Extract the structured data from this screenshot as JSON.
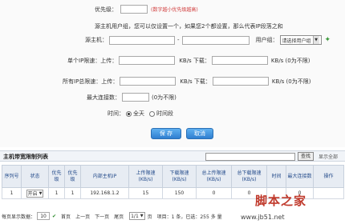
{
  "form": {
    "priority_label": "优先级：",
    "priority_hint": "(数字越小优先级越高)",
    "note_text": "源主机用户组，您可以仅设置一个，如果您2个都设置，那么代表IP段落之和",
    "source_host_label": "源主机：",
    "range_sep": "-",
    "user_group_label": "用户组：",
    "user_group_select": "请选择用户组",
    "single_ip_label": "单个IP限速：上传：",
    "all_ip_label": "所有IP总限速：上传：",
    "download_label": "KB/s  下载：",
    "kbs_no_limit": "KB/s (0为不限)",
    "max_conn_label": "最大连接数：",
    "max_conn_hint": "(0为不限)",
    "time_label": "时间：",
    "time_all": "全天",
    "time_period": "时间段",
    "save_button": "保 存",
    "cancel_button": "取消"
  },
  "list": {
    "title": "主机带宽限制列表",
    "search_button": "查找",
    "show_all": "显示全部",
    "columns": [
      "序列号",
      "状态",
      "优先级",
      "优先级",
      "内部主机IP",
      "上传限速(KB/s)",
      "下载限速(KB/s)",
      "总上传限速(KB/s)",
      "总下载限速(KB/s)",
      "时间",
      "最大连接数",
      "操作"
    ],
    "rows": [
      [
        "1",
        "开启",
        "1",
        "1",
        "192.168.1.2",
        "15",
        "150",
        "0",
        "0",
        "",
        "0",
        ""
      ]
    ]
  },
  "pager": {
    "per_page_label": "每页显示数据：",
    "per_page_value": "10",
    "first": "首页",
    "prev": "上一页",
    "next": "下一页",
    "last": "尾页",
    "page_select": "1/1",
    "goto_label": "页",
    "items_label": "项目：1 条，已选：255 多 量"
  },
  "watermark": {
    "text": "脚本之家",
    "url": "www.jb51.net"
  }
}
